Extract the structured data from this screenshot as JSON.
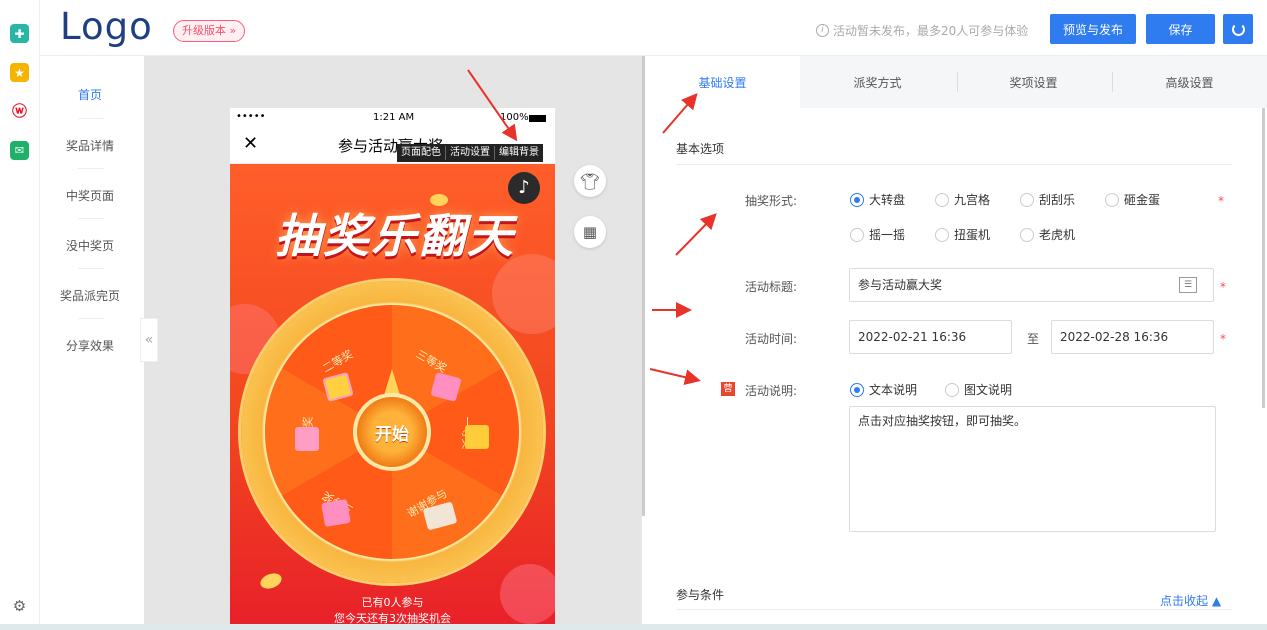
{
  "header": {
    "logo": "Logo",
    "upgrade_label": "升级版本 »",
    "hint_text": "活动暂未发布，最多20人可参与体验",
    "preview_publish_label": "预览与发布",
    "save_label": "保存"
  },
  "nav": {
    "items": [
      {
        "label": "首页"
      },
      {
        "label": "奖品详情"
      },
      {
        "label": "中奖页面"
      },
      {
        "label": "没中奖页"
      },
      {
        "label": "奖品派完页"
      },
      {
        "label": "分享效果"
      }
    ],
    "collapse_glyph": "«"
  },
  "phone": {
    "status_left": "•••••",
    "status_time": "1:21 AM",
    "status_right": "100%",
    "nav_title": "参与活动赢大奖",
    "close_glyph": "✕",
    "toolbar": [
      "页面配色",
      "活动设置",
      "编辑背景"
    ],
    "poster_title": "抽奖乐翻天",
    "wheel_center": "开始",
    "prizes": [
      "二等奖",
      "三等奖",
      "一等奖",
      "一等奖",
      "谢谢参与",
      "三等奖"
    ],
    "footer_line1": "已有0人参与",
    "footer_line2": "您今天还有3次抽奖机会"
  },
  "tabs": [
    "基础设置",
    "派奖方式",
    "奖项设置",
    "高级设置"
  ],
  "form": {
    "section_basic": "基本选项",
    "draw_type_label": "抽奖形式:",
    "draw_types": [
      "大转盘",
      "九宫格",
      "刮刮乐",
      "砸金蛋",
      "摇一摇",
      "扭蛋机",
      "老虎机"
    ],
    "draw_type_selected": "大转盘",
    "title_label": "活动标题:",
    "title_value": "参与活动赢大奖",
    "time_label": "活动时间:",
    "start_time": "2022-02-21 16:36",
    "time_sep": "至",
    "end_time": "2022-02-28 16:36",
    "desc_badge": "营",
    "desc_label": "活动说明:",
    "desc_types": [
      "文本说明",
      "图文说明"
    ],
    "desc_type_selected": "文本说明",
    "desc_value": "点击对应抽奖按钮，即可抽奖。",
    "section_participate": "参与条件",
    "collapse_link": "点击收起 ▲",
    "required_mark": "*"
  },
  "colors": {
    "accent": "#2f7bf0",
    "upgrade": "#ff4d6d",
    "poster_top": "#ff5e2a",
    "poster_bottom": "#e8202a",
    "arrow": "#e8332a"
  }
}
